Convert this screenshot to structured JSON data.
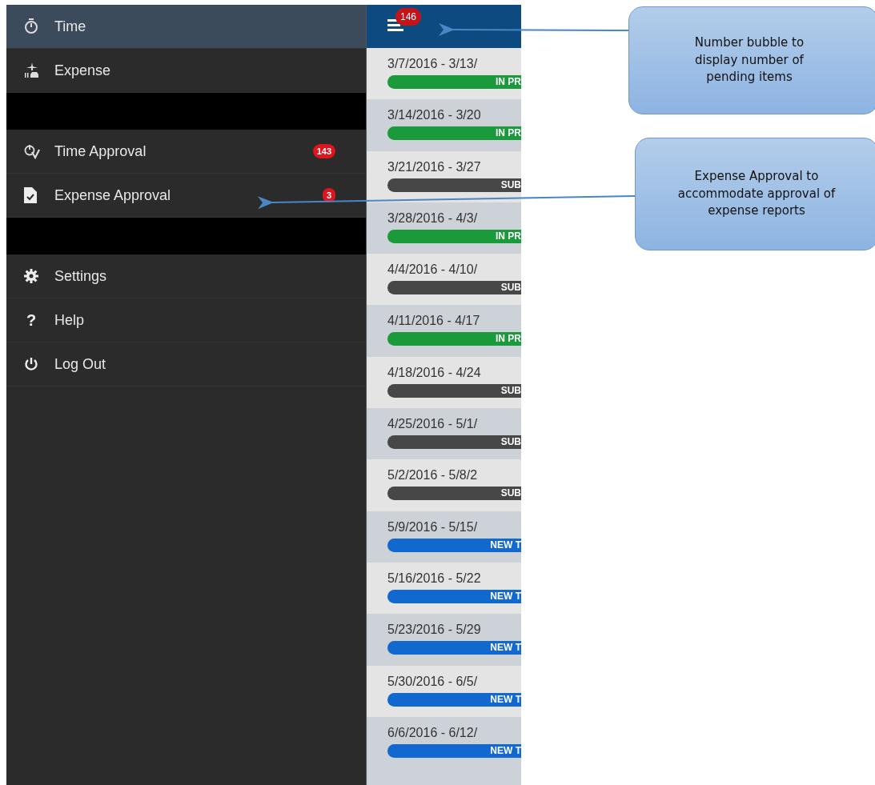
{
  "sidebar": {
    "groups": [
      {
        "items": [
          {
            "label": "Time",
            "kind": "stopwatch",
            "selected": true
          },
          {
            "label": "Expense",
            "kind": "travel",
            "selected": false
          }
        ]
      },
      {
        "items": [
          {
            "label": "Time Approval",
            "kind": "stopwatch-check",
            "selected": false,
            "badge": "143"
          },
          {
            "label": "Expense Approval",
            "kind": "document-check",
            "selected": false,
            "badge": "3"
          }
        ]
      },
      {
        "items": [
          {
            "label": "Settings",
            "kind": "gear",
            "selected": false
          },
          {
            "label": "Help",
            "kind": "glyph",
            "glyph": "?",
            "selected": false
          },
          {
            "label": "Log Out",
            "kind": "power",
            "selected": false
          }
        ]
      }
    ]
  },
  "header": {
    "badge": "146"
  },
  "timesheets": [
    {
      "period": "3/7/2016 - 3/13/",
      "status": "IN PR",
      "kind": "in_progress"
    },
    {
      "period": "3/14/2016 - 3/20",
      "status": "IN PR",
      "kind": "in_progress"
    },
    {
      "period": "3/21/2016 - 3/27",
      "status": "SUB",
      "kind": "submitted"
    },
    {
      "period": "3/28/2016 - 4/3/",
      "status": "IN PR",
      "kind": "in_progress"
    },
    {
      "period": "4/4/2016 - 4/10/",
      "status": "SUB",
      "kind": "submitted"
    },
    {
      "period": "4/11/2016 - 4/17",
      "status": "IN PR",
      "kind": "in_progress"
    },
    {
      "period": "4/18/2016 - 4/24",
      "status": "SUB",
      "kind": "submitted"
    },
    {
      "period": "4/25/2016 - 5/1/",
      "status": "SUB",
      "kind": "submitted"
    },
    {
      "period": "5/2/2016 - 5/8/2",
      "status": "SUB",
      "kind": "submitted"
    },
    {
      "period": "5/9/2016 - 5/15/",
      "status": "NEW T",
      "kind": "new"
    },
    {
      "period": "5/16/2016 - 5/22",
      "status": "NEW T",
      "kind": "new"
    },
    {
      "period": "5/23/2016 - 5/29",
      "status": "NEW T",
      "kind": "new"
    },
    {
      "period": "5/30/2016 - 6/5/",
      "status": "NEW T",
      "kind": "new"
    },
    {
      "period": "6/6/2016 - 6/12/",
      "status": "NEW T",
      "kind": "new"
    }
  ],
  "callouts": [
    {
      "text": "Number bubble to display number of pending items"
    },
    {
      "text": "Expense Approval to accommodate approval of expense reports"
    }
  ]
}
